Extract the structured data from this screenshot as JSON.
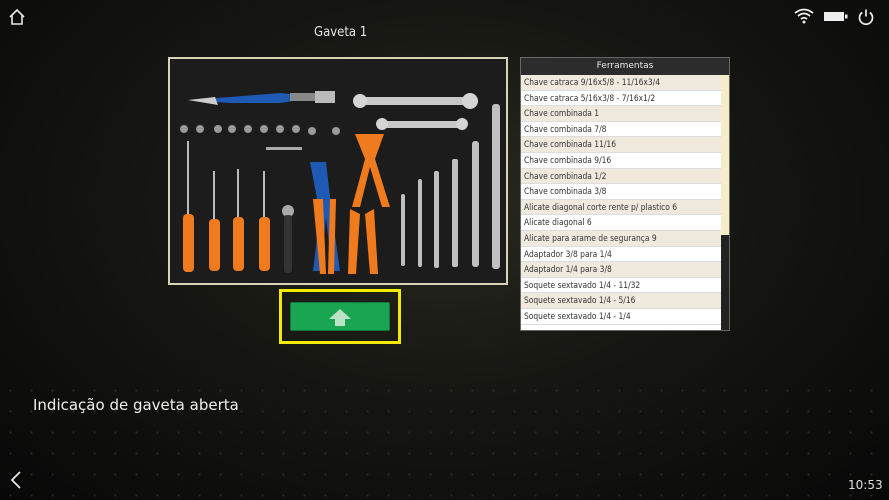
{
  "header": {
    "title": "Gaveta 1"
  },
  "icons": {
    "home": "home-icon",
    "wifi": "wifi-icon",
    "battery": "battery-icon",
    "power": "power-icon",
    "back": "back-arrow-icon",
    "open": "arrow-up-icon"
  },
  "table": {
    "header": "Ferramentas",
    "rows": [
      "Chave catraca 9/16x5/8 - 11/16x3/4",
      "Chave catraca 5/16x3/8 - 7/16x1/2",
      "Chave combinada 1",
      "Chave combinada 7/8",
      "Chave combinada 11/16",
      "Chave combinada 9/16",
      "Chave combinada 1/2",
      "Chave combinada 3/8",
      "Alicate diagonal corte rente p/ plastico 6",
      "Alicate diagonal 6",
      "Alicate para arame de segurança 9",
      "Adaptador 3/8 para 1/4",
      "Adaptador 1/4 para 3/8",
      "Soquete sextavado 1/4 - 11/32",
      "Soquete sextavado 1/4 - 5/16",
      "Soquete sextavado 1/4 - 1/4"
    ]
  },
  "status": {
    "message": "Indicação de gaveta aberta",
    "time": "10:53"
  },
  "colors": {
    "highlight": "#f2ea00",
    "open_button": "#1aa552",
    "tool_orange": "#f07a1e",
    "tool_blue": "#1e5ab4"
  }
}
